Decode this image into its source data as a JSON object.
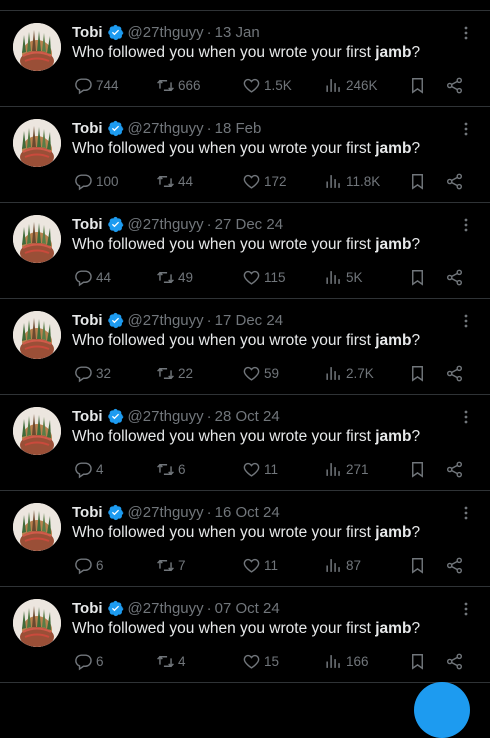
{
  "colors": {
    "background": "#000000",
    "text_primary": "#e7e9ea",
    "text_secondary": "#71767b",
    "verified_badge": "#1d9bf0",
    "fab": "#1d9bf0",
    "divider": "#2f3336"
  },
  "icons": {
    "reply": "reply-icon",
    "retweet": "retweet-icon",
    "like": "heart-icon",
    "views": "views-icon",
    "bookmark": "bookmark-icon",
    "share": "share-icon",
    "more": "more-vertical-icon",
    "verified": "verified-badge-icon"
  },
  "tweets": [
    {
      "name": "Tobi",
      "handle": "@27thguyy",
      "separator": "·",
      "date": "13 Jan",
      "text_before": "Who followed you when you wrote your first ",
      "text_bold": "jamb",
      "text_after": "?",
      "replies": "744",
      "retweets": "666",
      "likes": "1.5K",
      "views": "246K"
    },
    {
      "name": "Tobi",
      "handle": "@27thguyy",
      "separator": "·",
      "date": "18 Feb",
      "text_before": "Who followed you when you wrote your first ",
      "text_bold": "jamb",
      "text_after": "?",
      "replies": "100",
      "retweets": "44",
      "likes": "172",
      "views": "11.8K"
    },
    {
      "name": "Tobi",
      "handle": "@27thguyy",
      "separator": "·",
      "date": "27 Dec 24",
      "text_before": "Who followed you when you wrote your first ",
      "text_bold": "jamb",
      "text_after": "?",
      "replies": "44",
      "retweets": "49",
      "likes": "115",
      "views": "5K"
    },
    {
      "name": "Tobi",
      "handle": "@27thguyy",
      "separator": "·",
      "date": "17 Dec 24",
      "text_before": "Who followed you when you wrote your first ",
      "text_bold": "jamb",
      "text_after": "?",
      "replies": "32",
      "retweets": "22",
      "likes": "59",
      "views": "2.7K"
    },
    {
      "name": "Tobi",
      "handle": "@27thguyy",
      "separator": "·",
      "date": "28 Oct 24",
      "text_before": "Who followed you when you wrote your first ",
      "text_bold": "jamb",
      "text_after": "?",
      "replies": "4",
      "retweets": "6",
      "likes": "11",
      "views": "271"
    },
    {
      "name": "Tobi",
      "handle": "@27thguyy",
      "separator": "·",
      "date": "16 Oct 24",
      "text_before": "Who followed you when you wrote your first ",
      "text_bold": "jamb",
      "text_after": "?",
      "replies": "6",
      "retweets": "7",
      "likes": "11",
      "views": "87"
    },
    {
      "name": "Tobi",
      "handle": "@27thguyy",
      "separator": "·",
      "date": "07 Oct 24",
      "text_before": "Who followed you when you wrote your first ",
      "text_bold": "jamb",
      "text_after": "?",
      "replies": "6",
      "retweets": "4",
      "likes": "15",
      "views": "166"
    }
  ]
}
